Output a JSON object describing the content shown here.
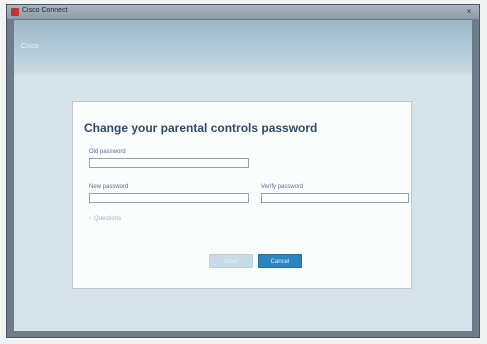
{
  "window": {
    "title": "Cisco Connect",
    "close_glyph": "×"
  },
  "banner": {
    "label": "Cisco"
  },
  "dialog": {
    "title": "Change your parental controls password",
    "old_password_label": "Old password",
    "new_password_label": "New password",
    "verify_password_label": "Verify password",
    "old_password_value": "",
    "new_password_value": "",
    "verify_password_value": "",
    "hint": "Questions",
    "hint_icon": "chevron-right-icon",
    "save_label": "Save",
    "cancel_label": "Cancel"
  },
  "colors": {
    "accent": "#2a85c0",
    "title": "#2f4b66",
    "banner": "#9db7c8"
  }
}
